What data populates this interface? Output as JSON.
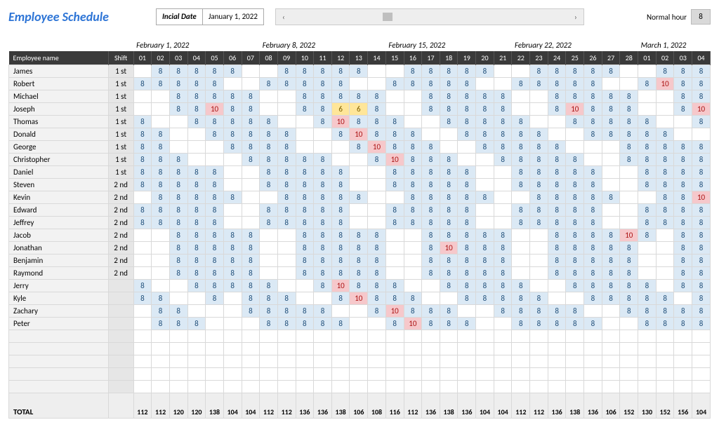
{
  "title": "Employee Schedule",
  "initial_date": {
    "label": "Incial Date",
    "value": "January 1, 2022"
  },
  "normal_hour": {
    "label": "Normal hour",
    "value": "8"
  },
  "month_headers": [
    {
      "label": "February 1, 2022",
      "span": 7,
      "start": 0
    },
    {
      "label": "February 8, 2022",
      "span": 7
    },
    {
      "label": "February 15, 2022",
      "span": 7
    },
    {
      "label": "February 22, 2022",
      "span": 7
    },
    {
      "label": "March 1, 2022",
      "span": 4
    }
  ],
  "columns": {
    "name": "Employee name",
    "shift": "Shift",
    "days": [
      "01",
      "02",
      "03",
      "04",
      "05",
      "06",
      "07",
      "08",
      "09",
      "10",
      "11",
      "12",
      "13",
      "14",
      "15",
      "16",
      "17",
      "18",
      "19",
      "20",
      "21",
      "22",
      "23",
      "24",
      "25",
      "26",
      "27",
      "28",
      "01",
      "02",
      "03",
      "04"
    ]
  },
  "rows": [
    {
      "name": "James",
      "shift": "1 st",
      "d": [
        null,
        8,
        8,
        8,
        8,
        8,
        null,
        null,
        8,
        8,
        8,
        8,
        8,
        null,
        null,
        8,
        8,
        8,
        8,
        8,
        null,
        null,
        8,
        8,
        8,
        8,
        8,
        null,
        null,
        8,
        8,
        8
      ]
    },
    {
      "name": "Robert",
      "shift": "1 st",
      "d": [
        8,
        8,
        8,
        8,
        8,
        null,
        null,
        8,
        8,
        8,
        8,
        8,
        null,
        null,
        8,
        8,
        8,
        8,
        8,
        null,
        null,
        8,
        8,
        8,
        8,
        8,
        null,
        null,
        8,
        10,
        8,
        8
      ]
    },
    {
      "name": "Michael",
      "shift": "1 st",
      "d": [
        null,
        null,
        8,
        8,
        8,
        8,
        8,
        null,
        null,
        8,
        8,
        8,
        8,
        8,
        null,
        null,
        8,
        8,
        8,
        8,
        8,
        null,
        null,
        8,
        8,
        8,
        8,
        8,
        null,
        null,
        8,
        8
      ]
    },
    {
      "name": "Joseph",
      "shift": "1 st",
      "d": [
        null,
        null,
        8,
        8,
        10,
        8,
        8,
        null,
        null,
        8,
        8,
        6,
        6,
        8,
        null,
        null,
        8,
        8,
        8,
        8,
        8,
        null,
        null,
        8,
        10,
        8,
        8,
        8,
        null,
        null,
        8,
        10
      ]
    },
    {
      "name": "Thomas",
      "shift": "1 st",
      "d": [
        8,
        null,
        null,
        8,
        8,
        8,
        8,
        8,
        null,
        null,
        8,
        10,
        8,
        8,
        8,
        null,
        null,
        8,
        8,
        8,
        8,
        8,
        null,
        null,
        8,
        8,
        8,
        8,
        8,
        null,
        null,
        8
      ]
    },
    {
      "name": "Donald",
      "shift": "1 st",
      "d": [
        8,
        8,
        null,
        null,
        8,
        8,
        8,
        8,
        8,
        null,
        null,
        8,
        10,
        8,
        8,
        8,
        null,
        null,
        8,
        8,
        8,
        8,
        8,
        null,
        null,
        8,
        8,
        8,
        8,
        8,
        null,
        null
      ]
    },
    {
      "name": "George",
      "shift": "1 st",
      "d": [
        8,
        8,
        null,
        null,
        null,
        8,
        8,
        8,
        8,
        null,
        null,
        null,
        8,
        10,
        8,
        8,
        8,
        null,
        null,
        8,
        8,
        8,
        8,
        8,
        null,
        null,
        null,
        8,
        8,
        8,
        8,
        8
      ]
    },
    {
      "name": "Christopher",
      "shift": "1 st",
      "d": [
        8,
        8,
        8,
        null,
        null,
        null,
        8,
        8,
        8,
        8,
        8,
        null,
        null,
        8,
        10,
        8,
        8,
        8,
        null,
        null,
        8,
        8,
        8,
        8,
        8,
        null,
        null,
        8,
        8,
        8,
        8,
        8
      ]
    },
    {
      "name": "Daniel",
      "shift": "1 st",
      "d": [
        8,
        8,
        8,
        8,
        8,
        null,
        null,
        8,
        8,
        8,
        8,
        8,
        null,
        null,
        8,
        8,
        8,
        8,
        8,
        null,
        null,
        8,
        8,
        8,
        8,
        8,
        null,
        null,
        8,
        8,
        8,
        8
      ]
    },
    {
      "name": "Steven",
      "shift": "2 nd",
      "d": [
        8,
        8,
        8,
        8,
        8,
        null,
        null,
        8,
        8,
        8,
        8,
        8,
        null,
        null,
        8,
        8,
        8,
        8,
        8,
        null,
        null,
        8,
        8,
        8,
        8,
        8,
        null,
        null,
        8,
        8,
        8,
        8
      ]
    },
    {
      "name": "Kevin",
      "shift": "2 nd",
      "d": [
        null,
        8,
        8,
        8,
        8,
        8,
        null,
        null,
        8,
        8,
        8,
        8,
        8,
        null,
        null,
        8,
        8,
        8,
        8,
        8,
        null,
        null,
        8,
        8,
        8,
        8,
        8,
        null,
        null,
        8,
        8,
        10
      ]
    },
    {
      "name": "Edward",
      "shift": "2 nd",
      "d": [
        8,
        8,
        8,
        8,
        8,
        null,
        null,
        8,
        8,
        8,
        8,
        8,
        null,
        null,
        8,
        8,
        8,
        8,
        8,
        null,
        null,
        8,
        8,
        8,
        8,
        8,
        null,
        null,
        8,
        8,
        8,
        8
      ]
    },
    {
      "name": "Jeffrey",
      "shift": "2 nd",
      "d": [
        8,
        8,
        8,
        8,
        8,
        null,
        null,
        8,
        8,
        8,
        8,
        8,
        null,
        null,
        8,
        8,
        8,
        8,
        8,
        null,
        null,
        8,
        8,
        8,
        8,
        8,
        null,
        null,
        8,
        8,
        8,
        8
      ]
    },
    {
      "name": "Jacob",
      "shift": "2 nd",
      "d": [
        null,
        null,
        8,
        8,
        8,
        8,
        8,
        null,
        null,
        8,
        8,
        8,
        8,
        8,
        null,
        null,
        8,
        8,
        8,
        8,
        8,
        null,
        null,
        8,
        8,
        8,
        8,
        10,
        8,
        null,
        8,
        8
      ]
    },
    {
      "name": "Jonathan",
      "shift": "2 nd",
      "d": [
        null,
        null,
        8,
        8,
        8,
        8,
        8,
        null,
        null,
        8,
        8,
        8,
        8,
        8,
        null,
        null,
        8,
        10,
        8,
        8,
        8,
        null,
        null,
        8,
        8,
        8,
        8,
        8,
        null,
        null,
        8,
        8
      ]
    },
    {
      "name": "Benjamin",
      "shift": "2 nd",
      "d": [
        null,
        null,
        8,
        8,
        8,
        8,
        8,
        null,
        null,
        8,
        8,
        8,
        8,
        8,
        null,
        null,
        8,
        8,
        8,
        8,
        8,
        null,
        null,
        8,
        8,
        8,
        8,
        8,
        null,
        null,
        8,
        8
      ]
    },
    {
      "name": "Raymond",
      "shift": "2 nd",
      "d": [
        null,
        null,
        8,
        8,
        8,
        8,
        8,
        null,
        null,
        8,
        8,
        8,
        8,
        8,
        null,
        null,
        8,
        8,
        8,
        8,
        8,
        null,
        null,
        8,
        8,
        8,
        8,
        8,
        null,
        null,
        8,
        8
      ]
    },
    {
      "name": "Jerry",
      "shift": "",
      "d": [
        8,
        null,
        null,
        8,
        8,
        8,
        8,
        8,
        null,
        null,
        8,
        10,
        8,
        8,
        8,
        null,
        null,
        8,
        8,
        8,
        8,
        8,
        null,
        null,
        8,
        8,
        8,
        8,
        8,
        null,
        8,
        8
      ]
    },
    {
      "name": "Kyle",
      "shift": "",
      "d": [
        8,
        8,
        null,
        null,
        8,
        null,
        8,
        8,
        8,
        null,
        null,
        8,
        10,
        8,
        8,
        8,
        null,
        null,
        8,
        8,
        8,
        8,
        8,
        null,
        null,
        8,
        8,
        8,
        8,
        8,
        null,
        8
      ]
    },
    {
      "name": "Zachary",
      "shift": "",
      "d": [
        null,
        8,
        8,
        null,
        null,
        null,
        8,
        8,
        8,
        8,
        8,
        null,
        null,
        8,
        10,
        8,
        8,
        8,
        null,
        null,
        8,
        8,
        8,
        8,
        8,
        null,
        null,
        8,
        8,
        8,
        8,
        8
      ]
    },
    {
      "name": "Peter",
      "shift": "",
      "d": [
        null,
        8,
        8,
        8,
        null,
        null,
        null,
        8,
        8,
        8,
        8,
        8,
        null,
        null,
        8,
        10,
        8,
        8,
        8,
        null,
        null,
        8,
        8,
        8,
        8,
        8,
        null,
        null,
        8,
        8,
        8,
        8
      ]
    }
  ],
  "empty_rows": 5,
  "totals": {
    "label": "TOTAL",
    "d": [
      112,
      112,
      120,
      120,
      138,
      104,
      104,
      112,
      112,
      136,
      136,
      138,
      106,
      108,
      116,
      112,
      136,
      138,
      136,
      104,
      104,
      112,
      112,
      136,
      138,
      136,
      106,
      152,
      130,
      152,
      156,
      104
    ]
  }
}
